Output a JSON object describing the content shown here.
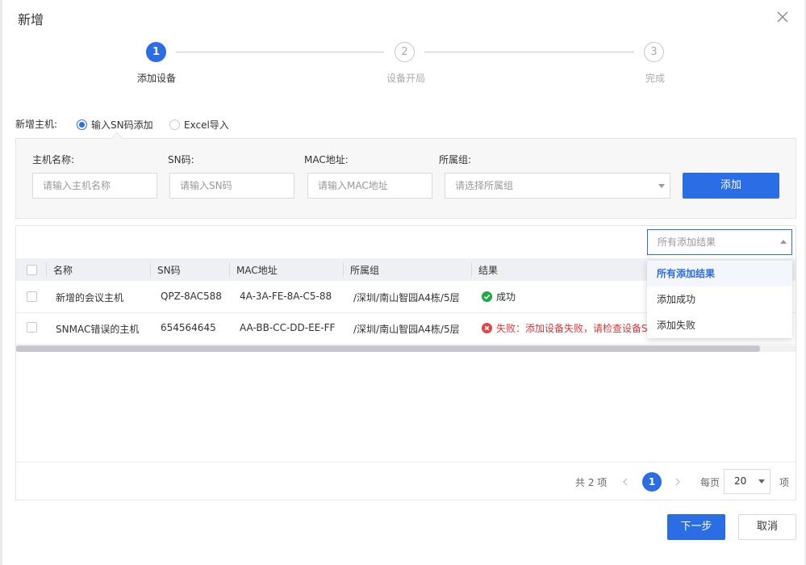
{
  "dialog": {
    "title": "新增"
  },
  "steps": [
    {
      "num": "1",
      "label": "添加设备",
      "state": "active"
    },
    {
      "num": "2",
      "label": "设备开局",
      "state": "idle"
    },
    {
      "num": "3",
      "label": "完成",
      "state": "idle"
    }
  ],
  "add_mode": {
    "label": "新增主机:",
    "options": [
      "输入SN码添加",
      "Excel导入"
    ],
    "selected": "输入SN码添加"
  },
  "form": {
    "host_name": {
      "label": "主机名称:",
      "placeholder": "请输入主机名称"
    },
    "sn": {
      "label": "SN码:",
      "placeholder": "请输入SN码"
    },
    "mac": {
      "label": "MAC地址:",
      "placeholder": "请输入MAC地址"
    },
    "group": {
      "label": "所属组:",
      "placeholder": "请选择所属组"
    },
    "add_label": "添加"
  },
  "filter": {
    "placeholder": "所有添加结果",
    "options": [
      "所有添加结果",
      "添加成功",
      "添加失败"
    ],
    "selected": "所有添加结果"
  },
  "table": {
    "columns": [
      "名称",
      "SN码",
      "MAC地址",
      "所属组",
      "结果"
    ],
    "rows": [
      {
        "name": "新增的会议主机",
        "sn": "QPZ-8AC588",
        "mac": "4A-3A-FE-8A-C5-88",
        "group": "/深圳/南山智园A4栋/5层",
        "result": "成功",
        "status": "success"
      },
      {
        "name": "SNMAC错误的主机",
        "sn": "654564645",
        "mac": "AA-BB-CC-DD-EE-FF",
        "group": "/深圳/南山智园A4栋/5层",
        "result": "失败：添加设备失败，请检查设备S",
        "status": "fail"
      }
    ]
  },
  "pagination": {
    "total_text": "共 2 项",
    "current_page": "1",
    "per_page_label": "每页",
    "page_size": "20",
    "unit": "项"
  },
  "footer": {
    "next_label": "下一步",
    "cancel_label": "取消"
  },
  "colors": {
    "primary": "#2b6de5",
    "success": "#22a845",
    "error": "#e04848"
  }
}
